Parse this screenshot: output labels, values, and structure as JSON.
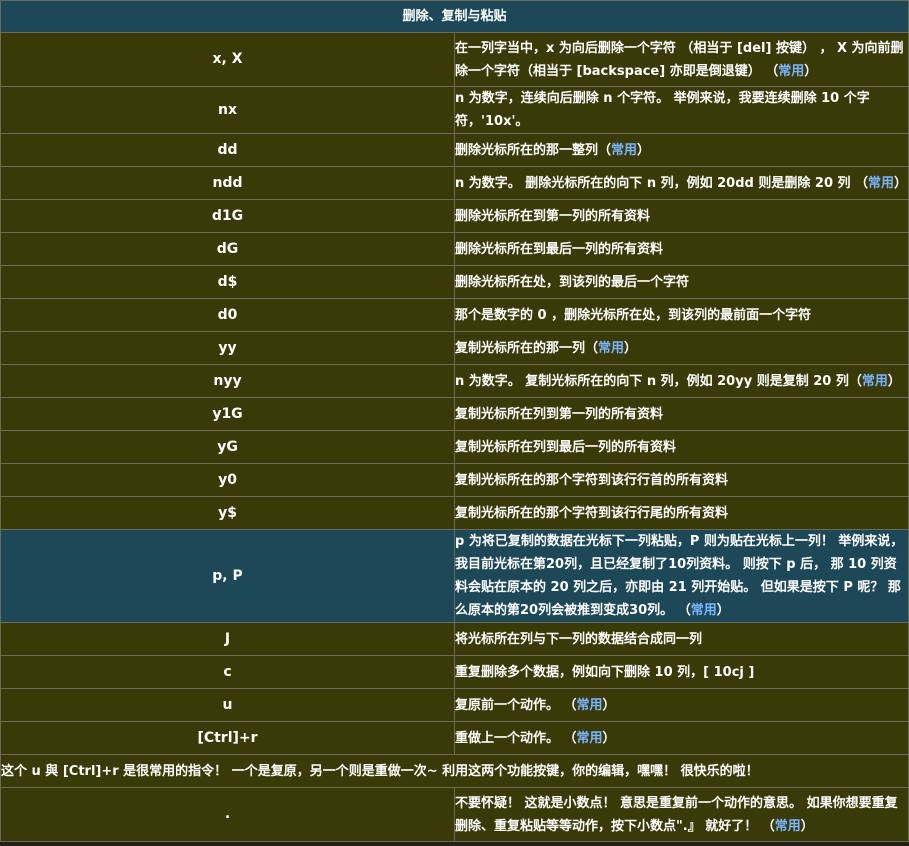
{
  "title": "删除、复制与粘贴",
  "common_label": "常用",
  "rows": [
    {
      "key": "x, X",
      "desc": "在一列字当中，x 为向后删除一个字符 （相当于 [del] 按键） ， X 为向前删除一个字符（相当于 [backspace] 亦即是倒退键） （",
      "common": true,
      "after": "）",
      "h": 54
    },
    {
      "key": "nx",
      "desc": "n 为数字，连续向后删除 n 个字符。 举例来说，我要连续删除 10 个字符，'10x'。",
      "common": false,
      "after": "",
      "h": 33
    },
    {
      "key": "dd",
      "desc": "删除光标所在的那一整列（",
      "common": true,
      "after": "）",
      "h": 33
    },
    {
      "key": "ndd",
      "desc": "n 为数字。 删除光标所在的向下 n 列，例如 20dd 则是删除 20 列 （",
      "common": true,
      "after": "）",
      "h": 33
    },
    {
      "key": "d1G",
      "desc": "删除光标所在到第一列的所有资料",
      "common": false,
      "after": "",
      "h": 33
    },
    {
      "key": "dG",
      "desc": "删除光标所在到最后一列的所有资料",
      "common": false,
      "after": "",
      "h": 33
    },
    {
      "key": "d$",
      "desc": "删除光标所在处，到该列的最后一个字符",
      "common": false,
      "after": "",
      "h": 33
    },
    {
      "key": "d0",
      "desc": "那个是数字的 0 ，删除光标所在处，到该列的最前面一个字符",
      "common": false,
      "after": "",
      "h": 33
    },
    {
      "key": "yy",
      "desc": "复制光标所在的那一列（",
      "common": true,
      "after": "）",
      "h": 33
    },
    {
      "key": "nyy",
      "desc": "n 为数字。 复制光标所在的向下 n 列，例如 20yy 则是复制 20 列（",
      "common": true,
      "after": "）",
      "h": 33
    },
    {
      "key": "y1G",
      "desc": "复制光标所在列到第一列的所有资料",
      "common": false,
      "after": "",
      "h": 33
    },
    {
      "key": "yG",
      "desc": "复制光标所在列到最后一列的所有资料",
      "common": false,
      "after": "",
      "h": 33
    },
    {
      "key": "y0",
      "desc": "复制光标所在的那个字符到该行行首的所有资料",
      "common": false,
      "after": "",
      "h": 33
    },
    {
      "key": "y$",
      "desc": "复制光标所在的那个字符到该行行尾的所有资料",
      "common": false,
      "after": "",
      "h": 33
    },
    {
      "key": "p, P",
      "desc": "p 为将已复制的数据在光标下一列粘贴，P 则为贴在光标上一列！ 举例来说，我目前光标在第20列，且已经复制了10列资料。 则按下 p 后， 那 10 列资料会贴在原本的 20 列之后，亦即由 21 列开始贴。 但如果是按下 P 呢？ 那么原本的第20列会被推到变成30列。 （",
      "common": true,
      "after": "）",
      "h": 78,
      "highlight": true
    },
    {
      "key": "J",
      "desc": "将光标所在列与下一列的数据结合成同一列",
      "common": false,
      "after": "",
      "h": 33
    },
    {
      "key": "c",
      "desc": "重复删除多个数据，例如向下删除 10 列，[ 10cj ]",
      "common": false,
      "after": "",
      "h": 33
    },
    {
      "key": "u",
      "desc": "复原前一个动作。 （",
      "common": true,
      "after": "）",
      "h": 33
    },
    {
      "key": "[Ctrl]+r",
      "desc": "重做上一个动作。 （",
      "common": true,
      "after": "）",
      "h": 33
    }
  ],
  "note": "这个 u 與 [Ctrl]+r 是很常用的指令！ 一个是复原，另一个则是重做一次~ 利用这两个功能按键，你的编辑，嘿嘿！ 很快乐的啦！",
  "last": {
    "key": ".",
    "desc": "不要怀疑！ 这就是小数点！ 意思是重复前一个动作的意思。 如果你想要重复删除、重复粘贴等等动作，按下小数点\".』 就好了！ （",
    "common": true,
    "after": "）"
  }
}
